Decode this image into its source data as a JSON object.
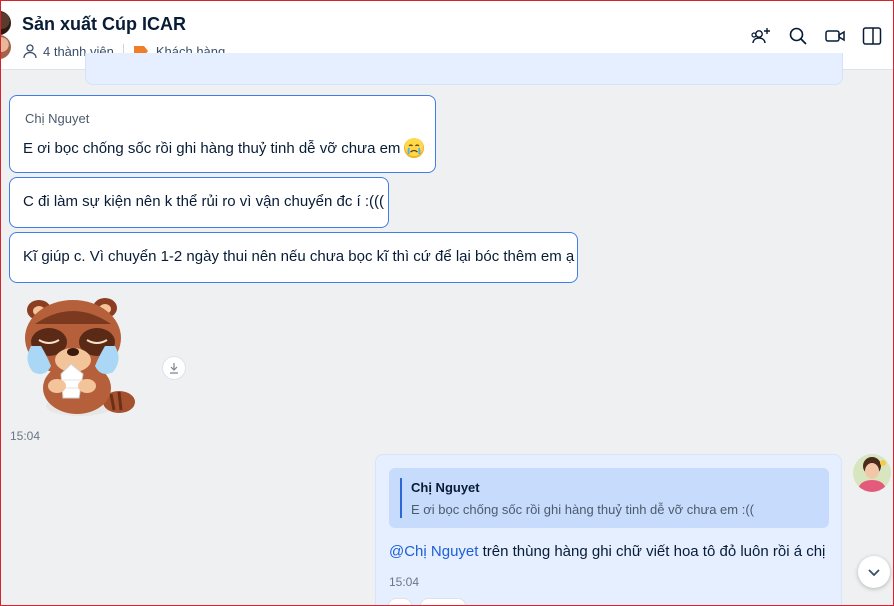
{
  "header": {
    "title": "Sản xuất Cúp ICAR",
    "members": "4 thành viên",
    "label": "Khách hàng",
    "label_color": "#f27d29",
    "icons": [
      "add-member-icon",
      "search-icon",
      "video-call-icon",
      "sidebar-toggle-icon"
    ]
  },
  "messages": {
    "m1": {
      "sender": "Chị Nguyet",
      "text": "E ơi bọc chống sốc rồi ghi hàng thuỷ tinh dễ vỡ chưa em",
      "emoji": "crying-face"
    },
    "m2": {
      "text": "C đi làm sự kiện nên k thể rủi ro vì vận chuyển đc í :((("
    },
    "m3": {
      "text": "Kĩ giúp c. Vì chuyển 1-2 ngày thui nên nếu chưa bọc kĩ thì cứ để lại bóc thêm em ạ"
    },
    "sticker": {
      "name": "crying-raccoon-sticker",
      "time": "15:04"
    },
    "reply": {
      "quote_name": "Chị Nguyet",
      "quote_text": "E ơi bọc chống sốc rồi ghi hàng thuỷ tinh dễ vỡ chưa em :((",
      "mention": "@Chị Nguyet",
      "text": " trên thùng hàng ghi chữ viết hoa tô đỏ luôn rồi á chị",
      "time": "15:04"
    }
  },
  "colors": {
    "accent": "#3f7ee8",
    "my_bubble": "#e5efff",
    "quote_bg": "#c7dcfd"
  }
}
